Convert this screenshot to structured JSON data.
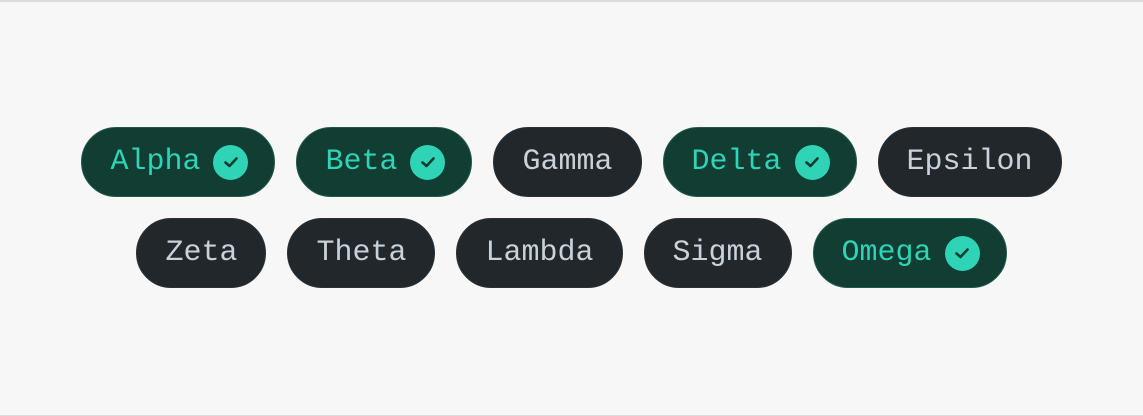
{
  "chip_group": {
    "rows": [
      {
        "chips": [
          {
            "label": "Alpha",
            "selected": true
          },
          {
            "label": "Beta",
            "selected": true
          },
          {
            "label": "Gamma",
            "selected": false
          },
          {
            "label": "Delta",
            "selected": true
          },
          {
            "label": "Epsilon",
            "selected": false
          }
        ]
      },
      {
        "chips": [
          {
            "label": "Zeta",
            "selected": false
          },
          {
            "label": "Theta",
            "selected": false
          },
          {
            "label": "Lambda",
            "selected": false
          },
          {
            "label": "Sigma",
            "selected": false
          },
          {
            "label": "Omega",
            "selected": true
          }
        ]
      }
    ],
    "colors": {
      "page_background": "#f7f7f7",
      "chip_background": "#22272b",
      "chip_text": "#c9d1d9",
      "selected_background": "#123d33",
      "selected_text": "#2fd3b5",
      "check_background": "#2fd3b5",
      "check_mark": "#123d33"
    },
    "selected_icon": "check-circle-icon"
  }
}
